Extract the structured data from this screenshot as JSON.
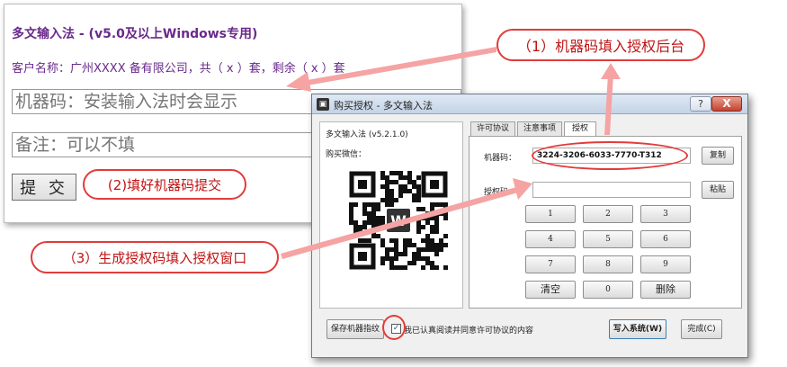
{
  "webform": {
    "title": "多文输入法 - (v5.0及以上Windows专用)",
    "customer": "客户名称：广州XXXX 备有限公司，共（ x ）套，剩余（ x ）套",
    "machine_placeholder": "机器码：安装输入法时会显示",
    "note_placeholder": "备注：可以不填",
    "submit_label": "提 交"
  },
  "callouts": {
    "step1": "（1）机器码填入授权后台",
    "step2": "(2)填好机器码提交",
    "step3": "（3）生成授权码填入授权窗口"
  },
  "dialog": {
    "title": "购买授权 - 多文输入法",
    "help_label": "?",
    "close_label": "X",
    "app_version": "多文输入法 (v5.2.1.0)",
    "wechat_label": "购买微信：",
    "qr_center_letter": "W",
    "tabs": [
      {
        "label": "许可协议"
      },
      {
        "label": "注意事项"
      },
      {
        "label": "授权"
      }
    ],
    "machine_code_label": "机器码：",
    "machine_code_value": "3224-3206-6033-7770-T312",
    "copy_label": "复制",
    "auth_code_label": "授权码：",
    "auth_code_value": "",
    "paste_label": "粘贴",
    "keypad": [
      "1",
      "2",
      "3",
      "4",
      "5",
      "6",
      "7",
      "8",
      "9",
      "清空",
      "0",
      "删除"
    ],
    "save_fingerprint_label": "保存机器指纹",
    "agree_checked": true,
    "agree_text": "我已认真阅读并同意许可协议的内容",
    "write_system_label": "写入系统(W)",
    "done_label": "完成(C)"
  },
  "colors": {
    "accent_red": "#e23b3b",
    "title_purple": "#6a2a8c",
    "arrow_pink": "#f08a8a"
  }
}
